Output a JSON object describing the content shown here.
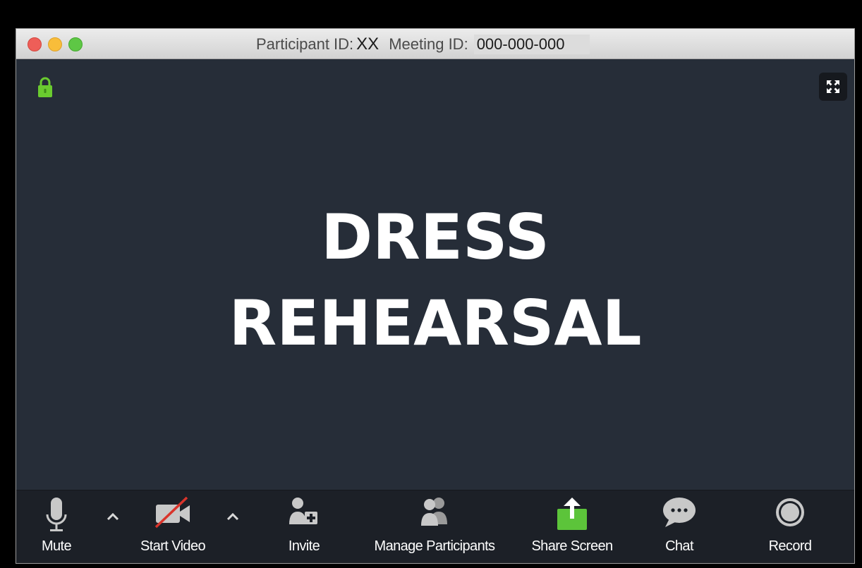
{
  "titlebar": {
    "participant_label": "Participant ID:",
    "participant_value": "XX",
    "meeting_label": "Meeting ID:",
    "meeting_value": "000-000-000"
  },
  "main": {
    "line1": "DRESS",
    "line2": "REHEARSAL"
  },
  "toolbar": {
    "mute_label": "Mute",
    "start_video_label": "Start Video",
    "invite_label": "Invite",
    "manage_participants_label": "Manage Participants",
    "share_screen_label": "Share Screen",
    "chat_label": "Chat",
    "record_label": "Record"
  },
  "colors": {
    "window_bg": "#262d38",
    "toolbar_bg": "#1c2027",
    "accent_green": "#5cc43a",
    "lock_green": "#6acb2f",
    "video_off_red": "#d9342b"
  },
  "icons": {
    "lock": "lock-icon",
    "fullscreen": "fullscreen-icon",
    "mute": "microphone-icon",
    "video": "video-off-icon",
    "invite": "invite-user-icon",
    "participants": "participants-icon",
    "share": "share-screen-icon",
    "chat": "chat-bubble-icon",
    "record": "record-icon"
  }
}
